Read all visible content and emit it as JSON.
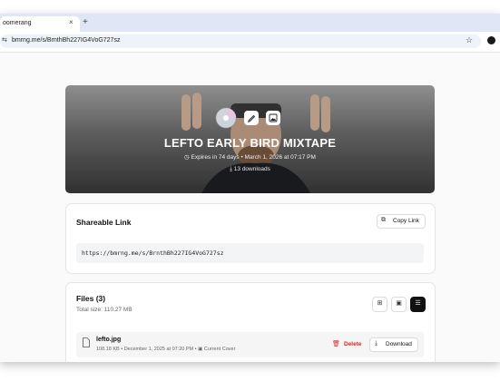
{
  "browser": {
    "tab_title": "oomerang",
    "tab_close": "×",
    "new_tab": "+",
    "url": "bmrng.me/s/BrnthBh227IG4VoG727sz",
    "tune_icon": "⇆",
    "star_icon": "☆"
  },
  "hero": {
    "title": "LEFTO EARLY BIRD MIXTAPE",
    "expires": "Expires in 74 days • March 1, 2026 at 07:17 PM",
    "downloads": "13 downloads",
    "clock_icon": "◷",
    "download_icon": "⤓"
  },
  "share": {
    "title": "Shareable Link",
    "copy_label": "Copy Link",
    "copy_icon": "⧉",
    "link": "https://bmrng.me/s/BrnthBh227IG4VoG727sz"
  },
  "files": {
    "title": "Files (3)",
    "total": "Total size: 110.27 MB",
    "view_icons": [
      "⊞",
      "▣",
      "☰"
    ],
    "items": [
      {
        "name": "lefto.jpg",
        "size": "108.18 KB",
        "date": "December 1, 2025 at 07:20 PM",
        "tag": "Current Cover",
        "tag_icon": "▣",
        "delete_label": "Delete",
        "delete_icon": "🗑",
        "download_label": "Download",
        "download_icon": "⤓"
      }
    ]
  },
  "colors": {
    "accent_dark": "#111111",
    "danger": "#dc2626",
    "tabbar": "#dfe7f6"
  }
}
